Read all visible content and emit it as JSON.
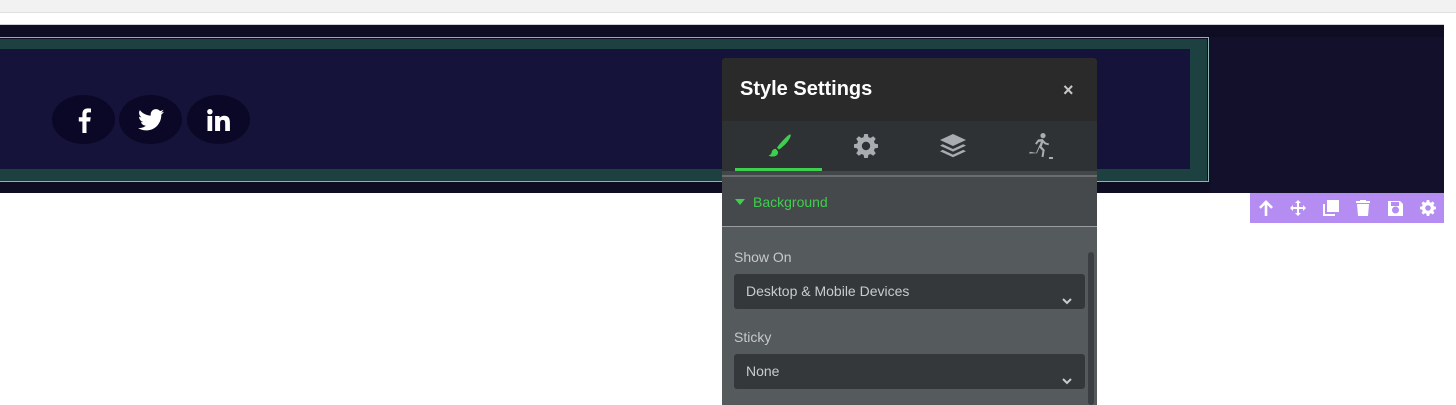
{
  "social": {
    "icons": [
      "facebook-icon",
      "twitter-icon",
      "linkedin-icon"
    ]
  },
  "element_toolbar": {
    "icons": [
      "arrow-up-icon",
      "move-icon",
      "duplicate-icon",
      "trash-icon",
      "save-icon",
      "settings-icon"
    ],
    "color": "#b48cf2"
  },
  "style_panel": {
    "title": "Style Settings",
    "close": "×",
    "tabs": [
      "brush-icon",
      "gear-icon",
      "layers-icon",
      "animation-icon"
    ],
    "active_tab": 0,
    "accent": "#3ecf4e",
    "section": "Background",
    "show_on": {
      "label": "Show On",
      "value": "Desktop & Mobile Devices"
    },
    "sticky": {
      "label": "Sticky",
      "value": "None"
    }
  }
}
